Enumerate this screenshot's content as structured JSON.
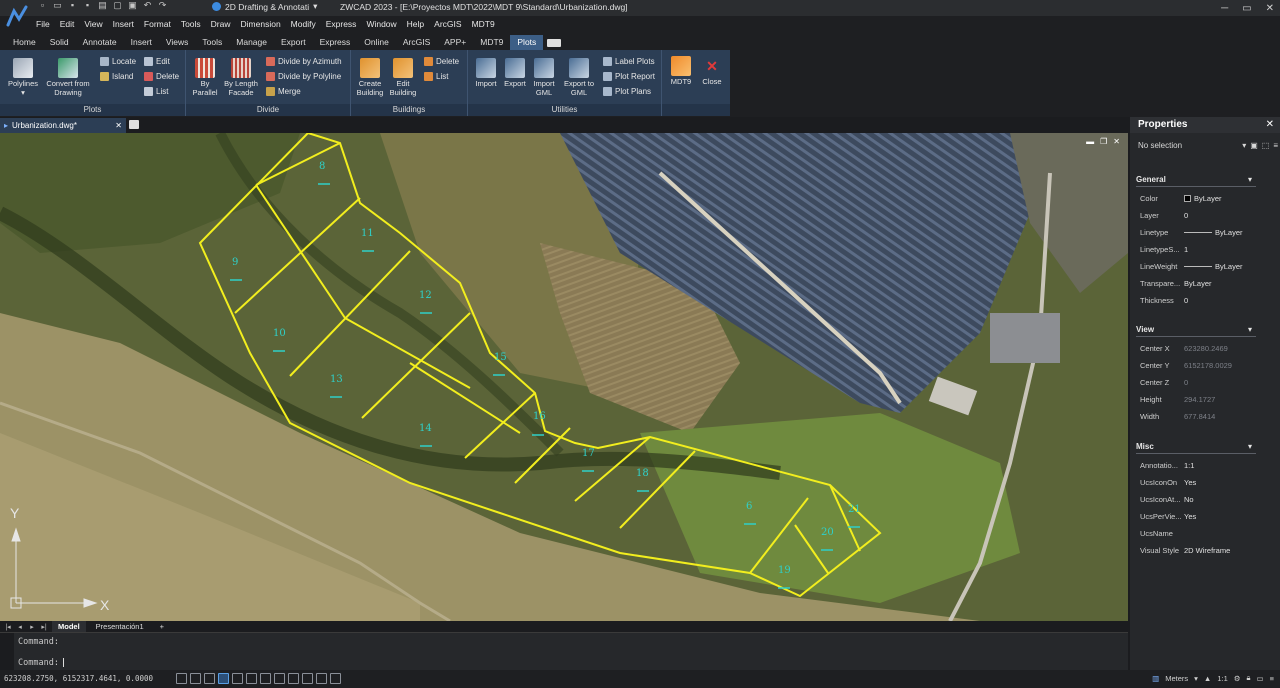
{
  "quick_access": {
    "workspace": "2D Drafting & Annotati"
  },
  "window_title": "ZWCAD 2023 - [E:\\Proyectos MDT\\2022\\MDT 9\\Standard\\Urbanization.dwg]",
  "menu": [
    "File",
    "Edit",
    "View",
    "Insert",
    "Format",
    "Tools",
    "Draw",
    "Dimension",
    "Modify",
    "Express",
    "Window",
    "Help",
    "ArcGIS",
    "MDT9"
  ],
  "ribbon_tabs": [
    "Home",
    "Solid",
    "Annotate",
    "Insert",
    "Views",
    "Tools",
    "Manage",
    "Export",
    "Express",
    "Online",
    "ArcGIS",
    "APP+",
    "MDT9",
    "Plots"
  ],
  "active_ribbon_tab": "Plots",
  "ribbon": {
    "plots": {
      "title": "Plots",
      "polylines": "Polylines",
      "convert_1": "Convert  from",
      "convert_2": "Drawing",
      "locate": "Locate",
      "island": "Island",
      "edit": "Edit",
      "delete": "Delete",
      "list": "List"
    },
    "divide": {
      "title": "Divide",
      "by_parallel_1": "By",
      "by_parallel_2": "Parallel",
      "by_length_1": "By Length",
      "by_length_2": "Facade",
      "by_azimuth": "Divide by Azimuth",
      "by_polyline": "Divide by Polyline",
      "merge": "Merge"
    },
    "buildings": {
      "title": "Buildings",
      "create_1": "Create",
      "create_2": "Building",
      "edit_1": "Edit",
      "edit_2": "Building",
      "delete": "Delete",
      "list": "List"
    },
    "utilities": {
      "title": "Utilities",
      "import": "Import",
      "export": "Export",
      "import_gml_1": "Import",
      "import_gml_2": "GML",
      "export_gml_1": "Export to",
      "export_gml_2": "GML",
      "label_plots": "Label Plots",
      "plot_report": "Plot Report",
      "plot_plans": "Plot Plans"
    },
    "mdt9": {
      "mdt9": "MDT9",
      "close": "Close"
    }
  },
  "document_tab": "Urbanization.dwg*",
  "plot_labels": [
    "8",
    "9",
    "11",
    "12",
    "10",
    "15",
    "13",
    "14",
    "16",
    "17",
    "18",
    "6",
    "20",
    "21",
    "19"
  ],
  "axis_labels": {
    "y": "Y",
    "x": "X"
  },
  "layout_tabs": [
    "Model",
    "Presentación1",
    "+"
  ],
  "command": {
    "line1": "Command:",
    "line2": "Command:"
  },
  "status": {
    "coords": "623208.2750, 6152317.4641, 0.0000",
    "units": "Meters",
    "scale": "1:1"
  },
  "properties": {
    "title": "Properties",
    "selection": "No selection",
    "general": {
      "title": "General",
      "rows": [
        {
          "k": "Color",
          "v": "ByLayer"
        },
        {
          "k": "Layer",
          "v": "0"
        },
        {
          "k": "Linetype",
          "v": "ByLayer"
        },
        {
          "k": "LinetypeS...",
          "v": "1"
        },
        {
          "k": "LineWeight",
          "v": "ByLayer"
        },
        {
          "k": "Transpare...",
          "v": "ByLayer"
        },
        {
          "k": "Thickness",
          "v": "0"
        }
      ]
    },
    "view": {
      "title": "View",
      "rows": [
        {
          "k": "Center X",
          "v": "623280.2469"
        },
        {
          "k": "Center Y",
          "v": "6152178.0029"
        },
        {
          "k": "Center Z",
          "v": "0"
        },
        {
          "k": "Height",
          "v": "294.1727"
        },
        {
          "k": "Width",
          "v": "677.8414"
        }
      ]
    },
    "misc": {
      "title": "Misc",
      "rows": [
        {
          "k": "Annotatio...",
          "v": "1:1"
        },
        {
          "k": "UcsIconOn",
          "v": "Yes"
        },
        {
          "k": "UcsIconAt...",
          "v": "No"
        },
        {
          "k": "UcsPerVie...",
          "v": "Yes"
        },
        {
          "k": "UcsName",
          "v": ""
        },
        {
          "k": "Visual Style",
          "v": "2D Wireframe"
        }
      ]
    }
  },
  "colors": {
    "plot_line": "#f2ee1e",
    "plot_label": "#2fd0c8",
    "ribbon_bg": "#2c3e55",
    "active_tab": "#3c5e86"
  }
}
